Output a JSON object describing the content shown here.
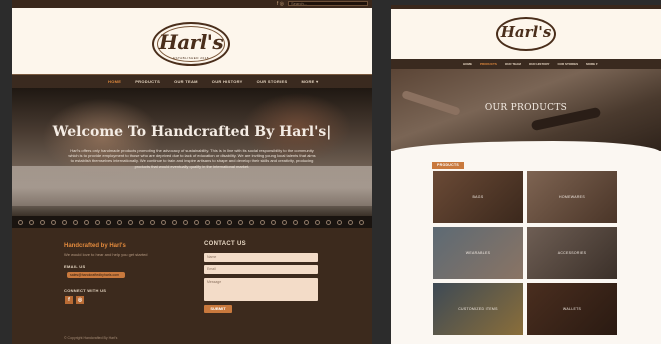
{
  "left": {
    "topbar": {
      "icons": "f  ◎",
      "search_placeholder": "Search..."
    },
    "logo": {
      "name": "Harl's",
      "tagline": "ESTABLISHED 2018"
    },
    "nav": [
      "HOME",
      "PRODUCTS",
      "OUR TEAM",
      "OUR HISTORY",
      "OUR STORIES",
      "MORE ▾"
    ],
    "hero": {
      "title": "Welcome To Handcrafted By Harl's|",
      "text": "Harl's offers only handmade products promoting the advocacy of sustainability. This is in line with its social responsibility to the community which is to provide employment to those who are deprived due to lack of education or disability. We are inviting young local talents that aims to establish themselves internationally. We continue to train and inspire artisans to shape and develop their skills and creativity, producing products that would eventually qualify in the international market."
    },
    "footer": {
      "title": "Handcrafted by Harl's",
      "tagline": "We would love to hear and help you get started",
      "email_label": "EMAIL US",
      "email": "sales@handcraftedbyharls.com",
      "connect_label": "CONNECT WITH US",
      "social": [
        "f",
        "◎"
      ],
      "contact_title": "CONTACT US",
      "name_placeholder": "Name",
      "email_placeholder": "Email",
      "message_placeholder": "Message",
      "submit": "SUBMIT",
      "copyright": "© Copyright Handcrafted By Harl's"
    }
  },
  "right": {
    "logo": {
      "name": "Harl's"
    },
    "nav": [
      "HOME",
      "PRODUCTS",
      "OUR TEAM",
      "OUR HISTORY",
      "OUR STORIES",
      "MORE ▾"
    ],
    "hero_title": "OUR PRODUCTS",
    "badge": "PRODUCTS",
    "products": [
      "BAGS",
      "HOMEWARES",
      "WEARABLES",
      "ACCESSORIES",
      "CUSTOMIZED ITEMS",
      "WALLETS"
    ]
  },
  "colors": {
    "accent": "#e28a3d",
    "brand_dark": "#3a2a1f",
    "cream": "#fdf6ec"
  }
}
